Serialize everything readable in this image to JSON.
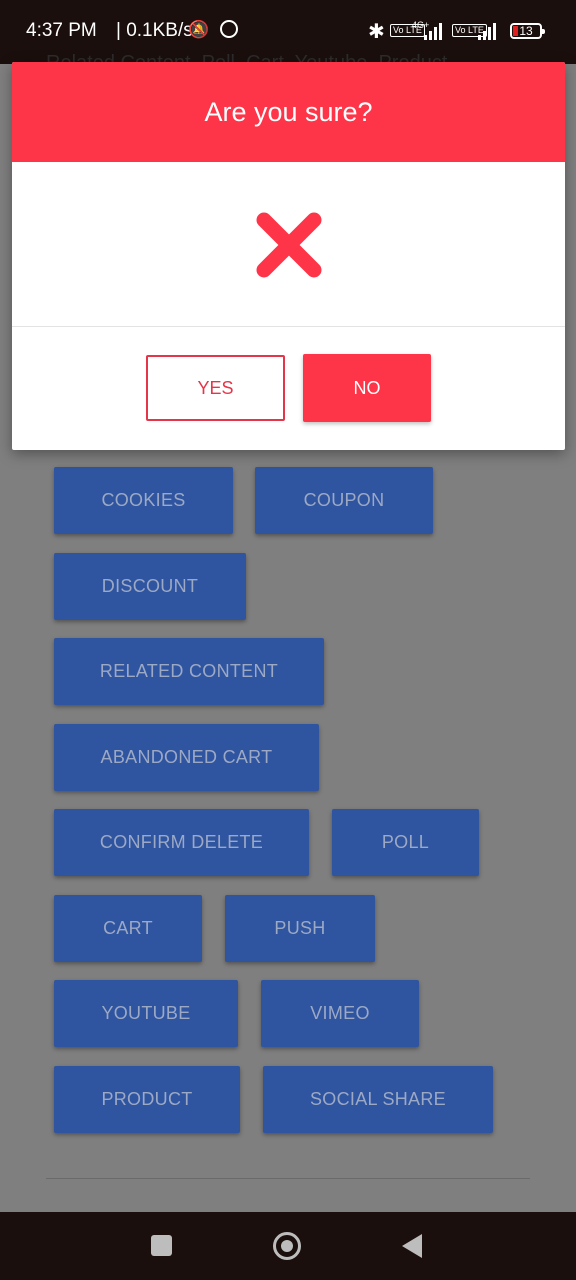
{
  "status_bar": {
    "time": "4:37 PM",
    "network_speed": "| 0.1KB/s",
    "network_type": "4G+",
    "volte_label": "Vo LTE",
    "battery": "13"
  },
  "page": {
    "title_text": "Related Content, Poll, Cart, Youtube, Product",
    "buttons": {
      "cookies": "COOKIES",
      "coupon": "COUPON",
      "discount": "DISCOUNT",
      "related_content": "RELATED CONTENT",
      "abandoned_cart": "ABANDONED CART",
      "confirm_delete": "CONFIRM DELETE",
      "poll": "POLL",
      "cart": "CART",
      "push": "PUSH",
      "youtube": "YOUTUBE",
      "vimeo": "VIMEO",
      "product": "PRODUCT",
      "social_share": "SOCIAL SHARE"
    }
  },
  "dialog": {
    "title": "Are you sure?",
    "icon": "close-x-icon",
    "yes_label": "YES",
    "no_label": "NO",
    "accent_color": "#fe3448"
  },
  "colors": {
    "button_blue": "#2f54a0",
    "overlay": "#7f7f7f"
  }
}
